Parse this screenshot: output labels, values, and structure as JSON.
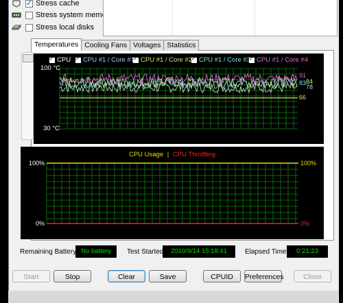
{
  "options": [
    {
      "label": "Stress cache",
      "checked": true,
      "icon": "cache-icon"
    },
    {
      "label": "Stress system memory",
      "checked": false,
      "icon": "memory-icon"
    },
    {
      "label": "Stress local disks",
      "checked": false,
      "icon": "disk-icon"
    }
  ],
  "tabs": [
    "Temperatures",
    "Cooling Fans",
    "Voltages",
    "Statistics"
  ],
  "temp_chart": {
    "legend": [
      {
        "label": "CPU",
        "color": "#ffffff"
      },
      {
        "label": "CPU #1 / Core #1",
        "color": "#9fd0ff"
      },
      {
        "label": "CPU #1 / Core #2",
        "color": "#cfe87a"
      },
      {
        "label": "CPU #1 / Core #3",
        "color": "#7fe0e0"
      },
      {
        "label": "CPU #1 / Core #4",
        "color": "#e070e0"
      }
    ],
    "y_top": "100 °C",
    "y_bottom": "30 °C",
    "ylim": [
      30,
      100
    ],
    "readouts": [
      {
        "value": "91",
        "color": "#e060e0"
      },
      {
        "value": "83",
        "color": "#7fe0e0"
      },
      {
        "value": "84",
        "color": "#cfe87a"
      },
      {
        "value": "78",
        "color": "#d0d0d0"
      },
      {
        "value": "66",
        "color": "#e0e060"
      }
    ]
  },
  "usage_chart": {
    "legend_usage": "CPU Usage",
    "legend_sep": "|",
    "legend_throttle": "CPU Throttling",
    "usage_color": "#e0e000",
    "throttle_color": "#ff2020",
    "left_top": "100%",
    "left_bottom": "0%",
    "right_top": "100%",
    "right_bottom": "0%"
  },
  "status": {
    "battery_label": "Remaining Battery:",
    "battery_value": "No battery",
    "started_label": "Test Started:",
    "started_value": "2010/9/14 15:18:41",
    "elapsed_label": "Elapsed Time:",
    "elapsed_value": "0:21:23"
  },
  "buttons": {
    "start": "Start",
    "stop": "Stop",
    "clear": "Clear",
    "save": "Save",
    "cpuid": "CPUID",
    "preferences": "Preferences",
    "close": "Close"
  }
}
